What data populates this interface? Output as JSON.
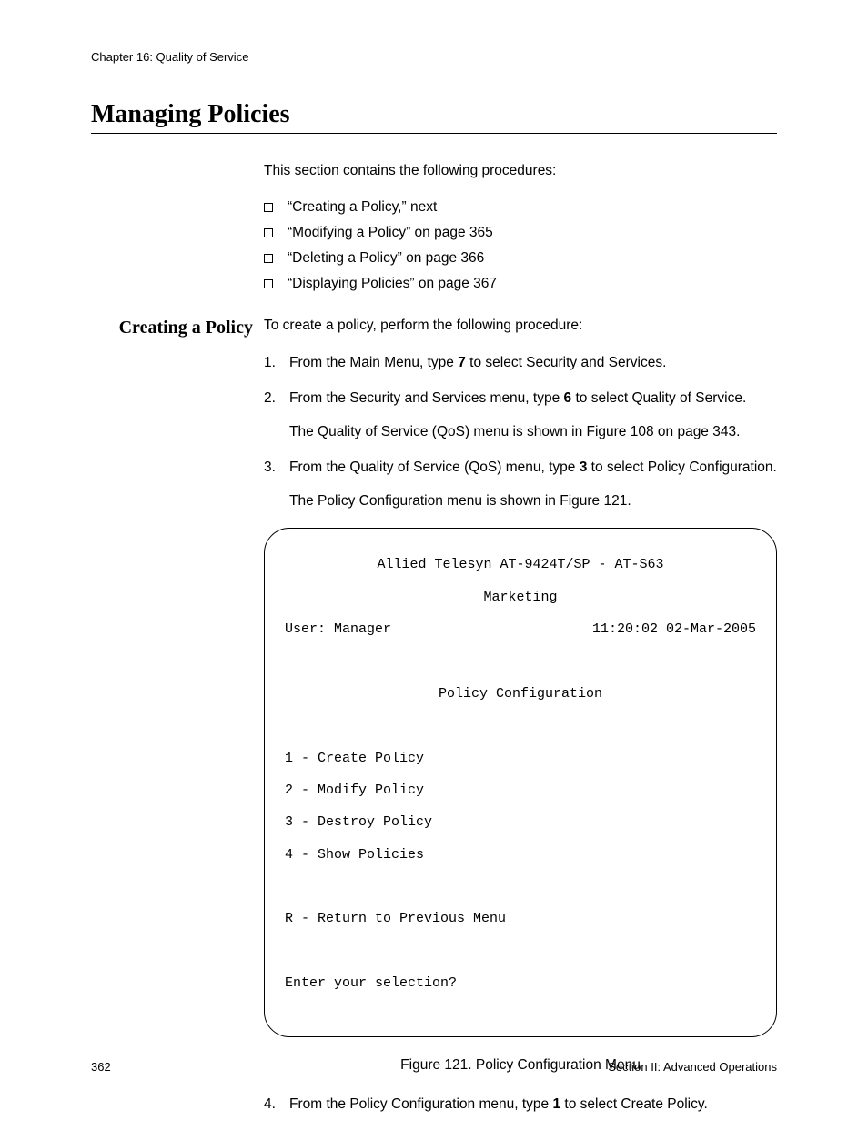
{
  "header": "Chapter 16: Quality of Service",
  "main_heading": "Managing Policies",
  "intro": "This section contains the following procedures:",
  "bullets": [
    "“Creating a Policy,”  next",
    "“Modifying a Policy” on page 365",
    "“Deleting a Policy” on page 366",
    "“Displaying Policies” on page 367"
  ],
  "side_heading": "Creating a Policy",
  "proc_intro": "To create a policy, perform the following procedure:",
  "steps": {
    "s1": {
      "num": "1.",
      "a": "From the Main Menu, type ",
      "b": "7",
      "c": " to select Security and Services."
    },
    "s2": {
      "num": "2.",
      "a": "From the Security and Services menu, type ",
      "b": "6",
      "c": " to select Quality of Service.",
      "p2": "The Quality of Service (QoS) menu is shown in Figure 108 on page 343."
    },
    "s3": {
      "num": "3.",
      "a": "From the Quality of Service (QoS) menu, type ",
      "b": "3",
      "c": " to select Policy Configuration.",
      "p2": "The Policy Configuration menu is shown in Figure 121."
    },
    "s4": {
      "num": "4.",
      "a": "From the Policy Configuration menu, type ",
      "b": "1",
      "c": " to select Create Policy."
    }
  },
  "terminal": {
    "line1": "Allied Telesyn AT-9424T/SP - AT-S63",
    "line2": "Marketing",
    "user_label": "User: Manager",
    "timestamp": "11:20:02 02-Mar-2005",
    "menu_title": "Policy Configuration",
    "opt1": "1 - Create Policy",
    "opt2": "2 - Modify Policy",
    "opt3": "3 - Destroy Policy",
    "opt4": "4 - Show Policies",
    "opt5": "R - Return to Previous Menu",
    "prompt": "Enter your selection?"
  },
  "fig_caption": "Figure 121. Policy Configuration Menu",
  "footer": {
    "page": "362",
    "section": "Section II: Advanced Operations"
  }
}
